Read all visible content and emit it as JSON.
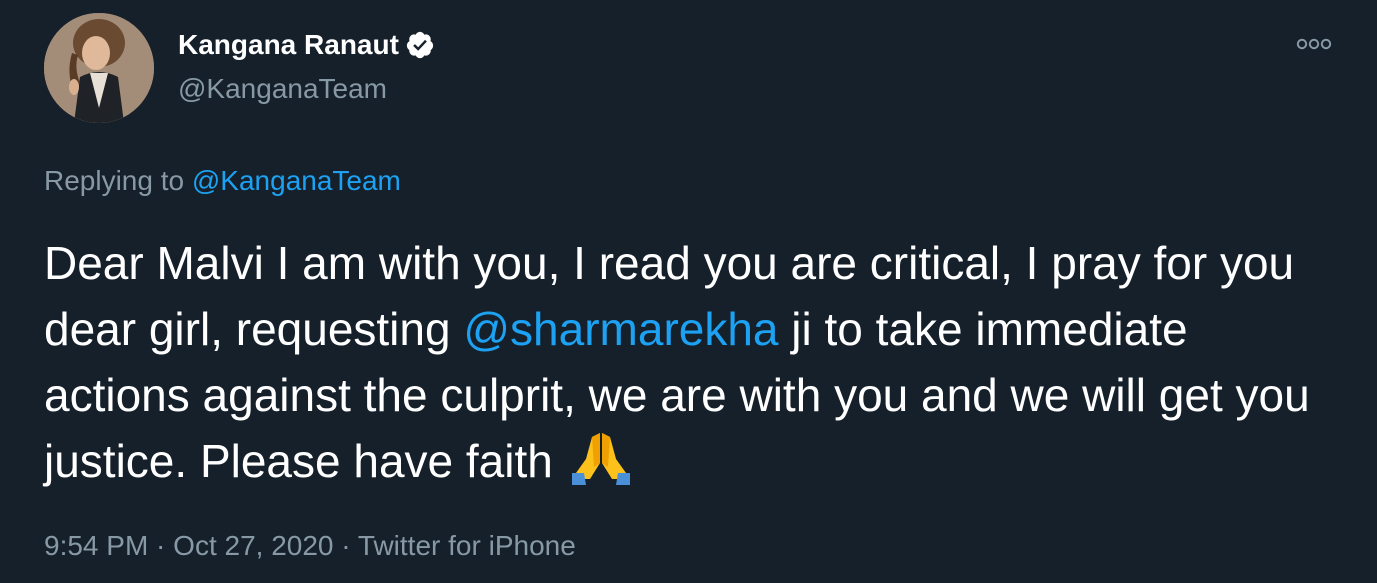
{
  "author": {
    "name": "Kangana Ranaut",
    "handle": "@KanganaTeam",
    "verified": true
  },
  "reply": {
    "prefix": "Replying to ",
    "mention": "@KanganaTeam"
  },
  "tweet": {
    "text_part1": "Dear Malvi I am with you, I read you are critical, I pray for you dear girl, requesting ",
    "mention": "@sharmarekha",
    "text_part2": " ji to take immediate actions against the culprit, we are with you and we will get you justice. Please have faith ",
    "emoji": "folded-hands-emoji"
  },
  "meta": {
    "time": "9:54 PM",
    "separator": " · ",
    "date": "Oct 27, 2020",
    "source": "Twitter for iPhone"
  },
  "colors": {
    "background": "#15202b",
    "text": "#ffffff",
    "secondary": "#8899a6",
    "link": "#1da1f2"
  },
  "icons": {
    "verified": "verified-badge-icon",
    "more": "more-options-icon"
  }
}
